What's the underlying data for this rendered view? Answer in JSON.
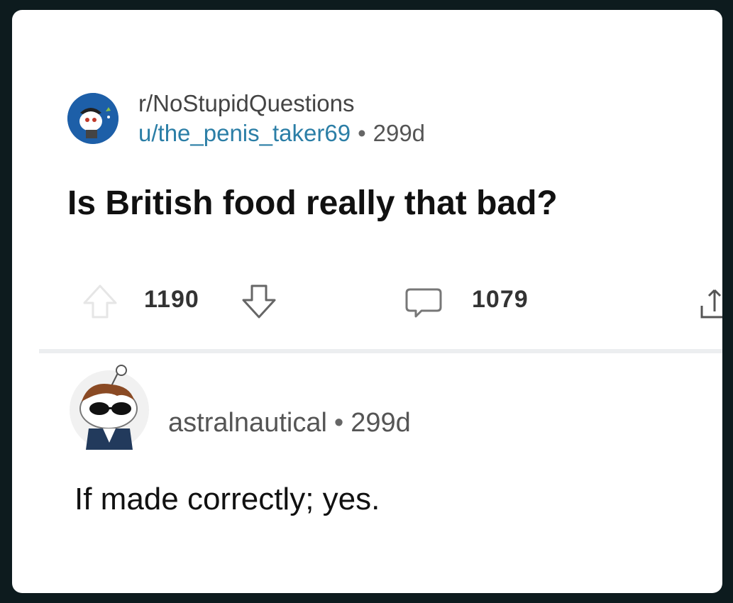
{
  "post": {
    "subreddit": "r/NoStupidQuestions",
    "author": "u/the_penis_taker69",
    "separator": "•",
    "age": "299d",
    "title": "Is British food really that bad?",
    "score": "1190",
    "comments_count": "1079"
  },
  "comment": {
    "author": "astralnautical",
    "separator": "•",
    "age": "299d",
    "body": "If made correctly; yes."
  },
  "icons": {
    "subreddit_avatar": "subreddit-avatar-icon",
    "upvote": "arrow-up-icon",
    "downvote": "arrow-down-icon",
    "comment": "speech-bubble-icon",
    "share": "share-icon",
    "user_avatar": "snoo-sunglasses-avatar"
  },
  "colors": {
    "background": "#0d1b1e",
    "card": "#ffffff",
    "author_link": "#2b7ea6",
    "subreddit_avatar_bg": "#1d5fa8"
  }
}
